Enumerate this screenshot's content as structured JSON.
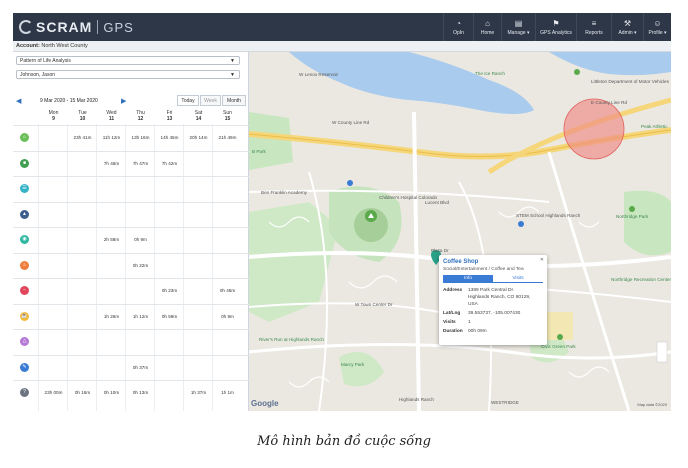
{
  "app": {
    "brand": "SCRAM",
    "product": "GPS"
  },
  "nav": [
    {
      "icon": "gauge-icon",
      "glyph": "◔",
      "label": "OpIn"
    },
    {
      "icon": "home-icon",
      "glyph": "⌂",
      "label": "Home"
    },
    {
      "icon": "manage-icon",
      "glyph": "▤",
      "label": "Manage ▾"
    },
    {
      "icon": "analytics-icon",
      "glyph": "⚑",
      "label": "GPS Analytics"
    },
    {
      "icon": "reports-icon",
      "glyph": "≡",
      "label": "Reports"
    },
    {
      "icon": "wrench-icon",
      "glyph": "⚒",
      "label": "Admin ▾"
    },
    {
      "icon": "user-icon",
      "glyph": "☺",
      "label": "Profile ▾"
    }
  ],
  "account": {
    "label": "Account:",
    "value": "North West County"
  },
  "filters": {
    "analysis": "Pattern of Life Analysis",
    "person": "Johnson, Jason"
  },
  "week": {
    "range": "9 Mar 2020 - 15 Mar 2020",
    "today": "Today",
    "week": "Week",
    "month": "Month"
  },
  "days": [
    {
      "dow": "Mon",
      "num": "9"
    },
    {
      "dow": "Tue",
      "num": "10"
    },
    {
      "dow": "Wed",
      "num": "11"
    },
    {
      "dow": "Thu",
      "num": "12"
    },
    {
      "dow": "Fri",
      "num": "13"
    },
    {
      "dow": "Sat",
      "num": "14"
    },
    {
      "dow": "Sun",
      "num": "15"
    }
  ],
  "rows": [
    {
      "icon": "home-icon",
      "glyph": "⌂",
      "color": "#6bbf59",
      "cells": [
        "",
        "23h 41m",
        "11h 12m",
        "13h 16m",
        "14h 45m",
        "20h 14m",
        "21h 49m"
      ]
    },
    {
      "icon": "work-icon",
      "glyph": "■",
      "color": "#3f9e4f",
      "cells": [
        "",
        "",
        "7h 46m",
        "7h 47m",
        "7h 42m",
        "",
        ""
      ]
    },
    {
      "icon": "chat-icon",
      "glyph": "☰",
      "color": "#35b3c7",
      "cells": [
        "",
        "",
        "",
        "",
        "",
        "",
        ""
      ]
    },
    {
      "icon": "building-icon",
      "glyph": "▲",
      "color": "#3a5f8a",
      "cells": [
        "",
        "",
        "",
        "",
        "",
        "",
        ""
      ]
    },
    {
      "icon": "pill-icon",
      "glyph": "◉",
      "color": "#2fb7a2",
      "cells": [
        "",
        "",
        "2h 58m",
        "0h 9m",
        "",
        "",
        ""
      ]
    },
    {
      "icon": "food-icon",
      "glyph": "♨",
      "color": "#ef7d3a",
      "cells": [
        "",
        "",
        "",
        "0h 22m",
        "",
        "",
        ""
      ]
    },
    {
      "icon": "no-entry-icon",
      "glyph": "−",
      "color": "#e0455a",
      "cells": [
        "",
        "",
        "",
        "",
        "0h 23m",
        "",
        "0h 46m"
      ]
    },
    {
      "icon": "coffee-icon",
      "glyph": "☕",
      "color": "#f2b93a",
      "cells": [
        "",
        "",
        "1h 26m",
        "1h 12m",
        "0h 59m",
        "",
        "0h 9m"
      ]
    },
    {
      "icon": "triangle-icon",
      "glyph": "△",
      "color": "#b67ad6",
      "cells": [
        "",
        "",
        "",
        "",
        "",
        "",
        ""
      ]
    },
    {
      "icon": "pin-icon",
      "glyph": "✎",
      "color": "#3a7bd5",
      "cells": [
        "",
        "",
        "",
        "0h 37m",
        "",
        "",
        ""
      ]
    },
    {
      "icon": "unknown-icon",
      "glyph": "?",
      "color": "#6b7480",
      "cells": [
        "23h 00m",
        "0h 16m",
        "0h 10m",
        "0h 13m",
        "",
        "1h 37m",
        "1h 1m"
      ]
    }
  ],
  "map_labels": [
    {
      "name": "label-jim-lenox-reservoir",
      "text": "W Lenox Reservoir",
      "green": false
    },
    {
      "name": "label-ice-ranch",
      "text": "The Ice Ranch",
      "green": true
    },
    {
      "name": "label-dmv",
      "text": "Littleton Department of Motor Vehicles",
      "green": false
    },
    {
      "name": "label-county-line-rd",
      "text": "W County Line Rd",
      "green": false
    },
    {
      "name": "label-e-county-line-rd",
      "text": "E County Line Rd",
      "green": false
    },
    {
      "name": "label-peak-athletic",
      "text": "Peak Athletic",
      "green": true
    },
    {
      "name": "label-park",
      "text": "B Park",
      "green": true
    },
    {
      "name": "label-franklin-academy",
      "text": "Ben Franklin Academy",
      "green": false
    },
    {
      "name": "label-childrens-hospital",
      "text": "Children's Hospital Colorado",
      "green": false
    },
    {
      "name": "label-stem-school",
      "text": "STEM School Highlands Ranch",
      "green": false
    },
    {
      "name": "label-northridge-park",
      "text": "Northridge Park",
      "green": true
    },
    {
      "name": "label-northridge-rec",
      "text": "Northridge Recreation Center",
      "green": true
    },
    {
      "name": "label-town-center",
      "text": "W Town Center Dr",
      "green": false
    },
    {
      "name": "label-river-run",
      "text": "River's Run at Highlands Ranch",
      "green": true
    },
    {
      "name": "label-marcy-park",
      "text": "Marcy Park",
      "green": true
    },
    {
      "name": "label-civic-green",
      "text": "Civic Green Park",
      "green": true
    },
    {
      "name": "label-highlands-ranch",
      "text": "Highlands Ranch",
      "green": false
    },
    {
      "name": "label-westridge",
      "text": "WESTRIDGE",
      "green": false
    },
    {
      "name": "label-plaza",
      "text": "Plaza Dr",
      "green": false
    },
    {
      "name": "label-lucent",
      "text": "Lucent Blvd",
      "green": false
    }
  ],
  "popup": {
    "title": "Coffee Shop",
    "subtitle": "Social/Entertainment / Coffee and Tea",
    "tab_info": "Info",
    "tab_visits": "Visits",
    "address_label": "Address",
    "address_1": "1389 Park Central Dr.",
    "address_2": "Highlands Ranch, CO 80129,",
    "address_3": "USA",
    "latlng_label": "Lat/Lng",
    "latlng": "39.553737, -105.007430",
    "visits_label": "Visits",
    "visits": "1",
    "duration_label": "Duration",
    "duration": "00h 09m"
  },
  "map_footer": {
    "google": "Google",
    "attribution": "Map data ©2020"
  },
  "caption": "Mô hình bản đồ cuộc sống"
}
